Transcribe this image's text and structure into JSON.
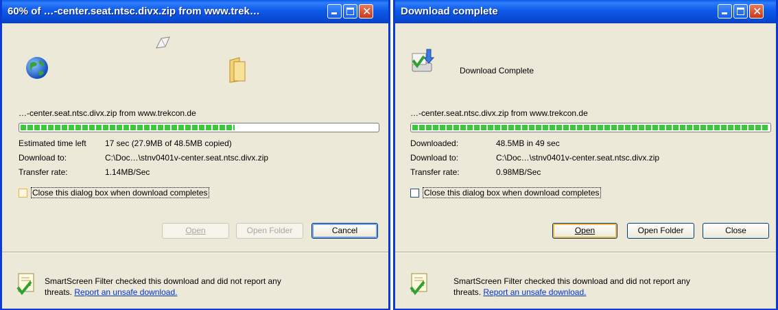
{
  "dialog_progress": {
    "title": "60% of …-center.seat.ntsc.divx.zip from www.trek…",
    "source_line": "…-center.seat.ntsc.divx.zip from www.trekcon.de",
    "progress_fraction": 0.6,
    "rows": [
      {
        "label": "Estimated time left",
        "value": "17 sec (27.9MB of 48.5MB copied)"
      },
      {
        "label": "Download to:",
        "value": "C:\\Doc…\\stnv0401v-center.seat.ntsc.divx.zip"
      },
      {
        "label": "Transfer rate:",
        "value": "1.14MB/Sec"
      }
    ],
    "checkbox_label": "Close this dialog box when download completes",
    "checkbox_checked": false,
    "buttons": {
      "open": "Open",
      "open_folder": "Open Folder",
      "cancel": "Cancel"
    },
    "smartscreen_text": "SmartScreen Filter checked this download and did not report any",
    "smartscreen_text2": "threats.",
    "smartscreen_link": "Report an unsafe download."
  },
  "dialog_complete": {
    "title": "Download complete",
    "heading": "Download Complete",
    "source_line": "…-center.seat.ntsc.divx.zip from www.trekcon.de",
    "progress_fraction": 1.0,
    "rows": [
      {
        "label": "Downloaded:",
        "value": "48.5MB in 49 sec"
      },
      {
        "label": "Download to:",
        "value": "C:\\Doc…\\stnv0401v-center.seat.ntsc.divx.zip"
      },
      {
        "label": "Transfer rate:",
        "value": "0.98MB/Sec"
      }
    ],
    "checkbox_label": "Close this dialog box when download completes",
    "checkbox_checked": false,
    "buttons": {
      "open": "Open",
      "open_folder": "Open Folder",
      "close": "Close"
    },
    "smartscreen_text": "SmartScreen Filter checked this download and did not report any",
    "smartscreen_text2": "threats.",
    "smartscreen_link": "Report an unsafe download."
  },
  "icons": [
    "globe-icon",
    "flying-paper-icon",
    "folder-icon",
    "download-complete-icon",
    "smartscreen-shield-icon",
    "minimize-icon",
    "maximize-icon",
    "close-icon"
  ],
  "colors": {
    "titlebar": "#0a4fd9",
    "dialog_bg": "#ece9d8",
    "progress_green": "#3bc93b",
    "link": "#0033cc"
  }
}
